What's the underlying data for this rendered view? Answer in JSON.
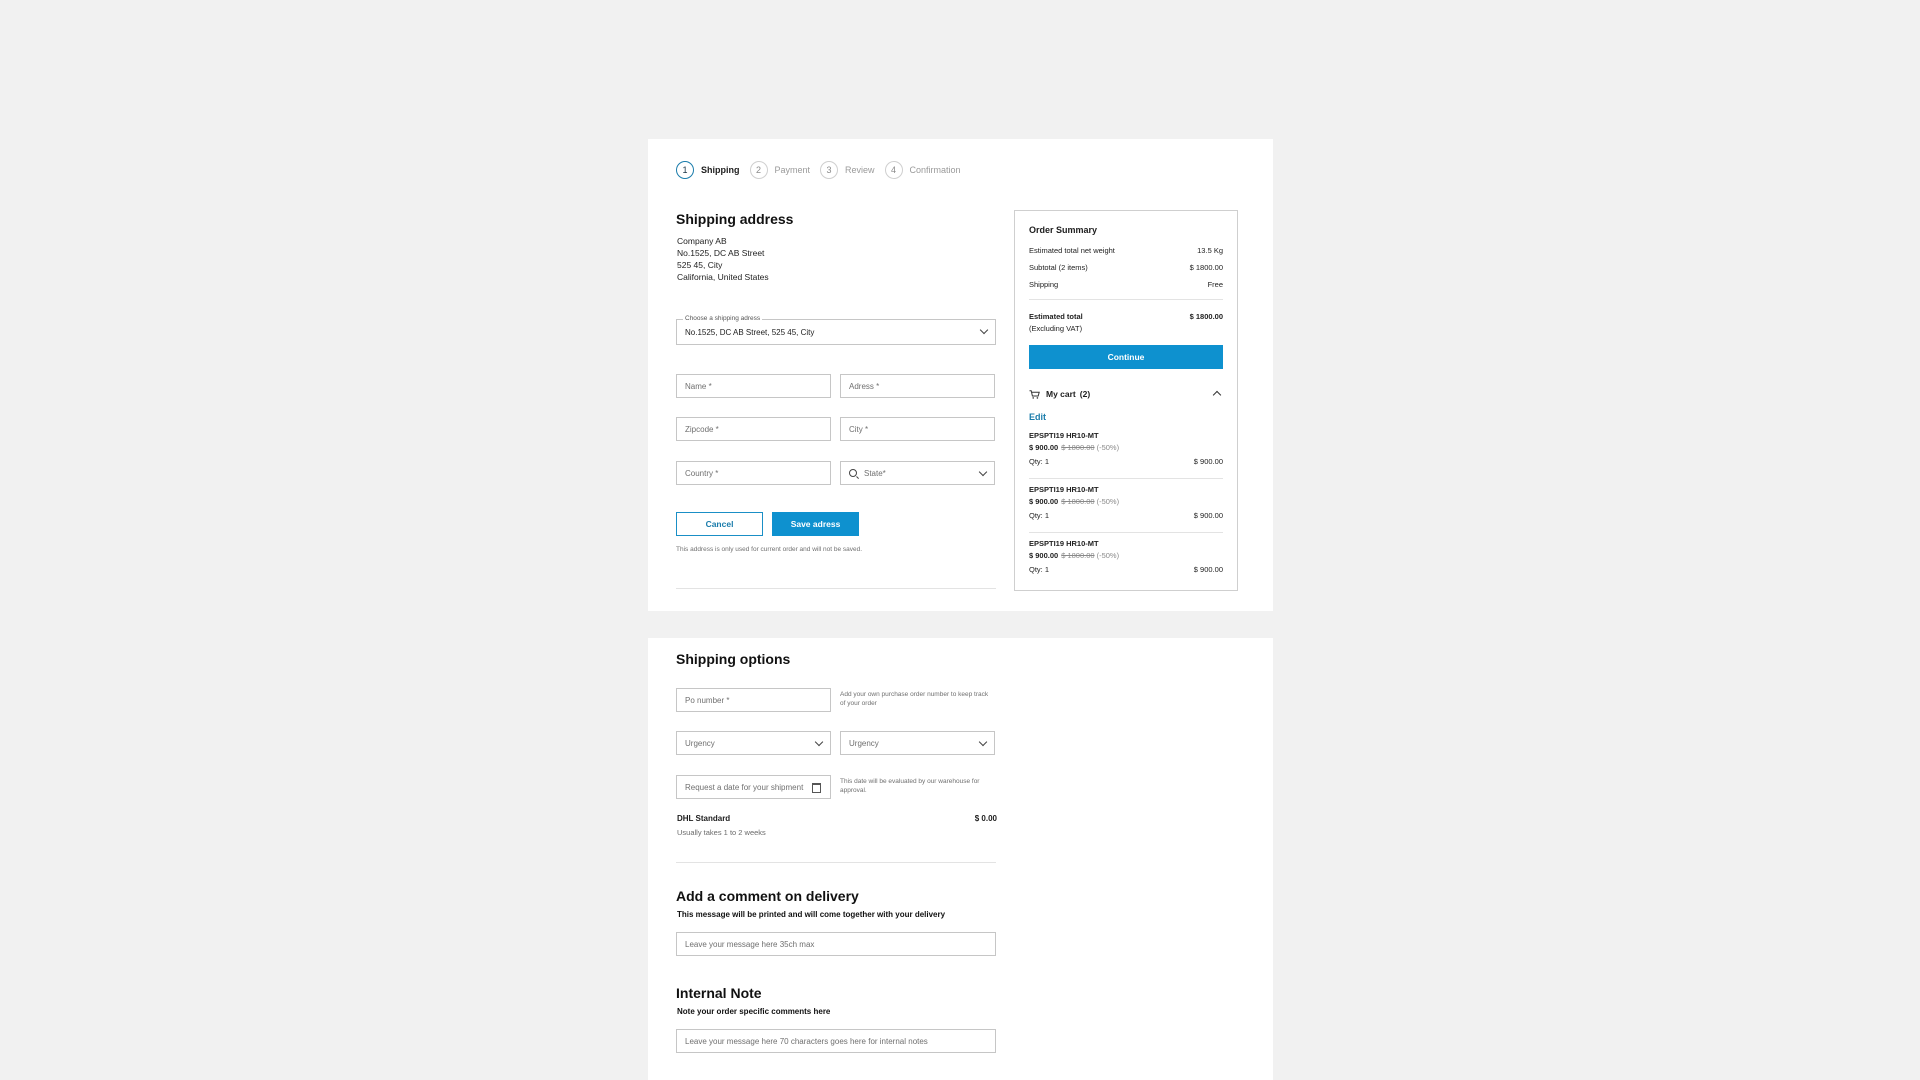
{
  "stepper": [
    {
      "number": "1",
      "label": "Shipping"
    },
    {
      "number": "2",
      "label": "Payment"
    },
    {
      "number": "3",
      "label": "Review"
    },
    {
      "number": "4",
      "label": "Confirmation"
    }
  ],
  "shipping_address": {
    "title": "Shipping address",
    "lines": [
      "Company AB",
      "No.1525, DC AB Street",
      "525 45, City",
      "California, United States"
    ],
    "select_label": "Choose a shipping adress",
    "select_value": "No.1525, DC AB Street, 525 45, City",
    "fields": {
      "name": "Name *",
      "address": "Adress *",
      "zipcode": "Zipcode *",
      "city": "City *",
      "country": "Country *",
      "state": "State*"
    },
    "cancel_label": "Cancel",
    "save_label": "Save adress",
    "note": "This address is only used for current order and will not be saved."
  },
  "order_summary": {
    "title": "Order Summary",
    "rows": [
      {
        "label": "Estimated total net weight",
        "value": "13.5 Kg"
      },
      {
        "label": "Subtotal (2 items)",
        "value": "$ 1800.00"
      },
      {
        "label": "Shipping",
        "value": "Free"
      }
    ],
    "total_label": "Estimated total",
    "total_sub": "(Excluding VAT)",
    "total_value": "$ 1800.00",
    "continue_label": "Continue",
    "cart_label": "My cart",
    "cart_count": "(2)",
    "edit_label": "Edit",
    "items": [
      {
        "name": "EPSPTI19 HR10-MT",
        "price": "$ 900.00",
        "old_price": "$ 1800.00",
        "discount": "(-50%)",
        "qty": "Qty: 1",
        "line_total": "$ 900.00"
      },
      {
        "name": "EPSPTI19 HR10-MT",
        "price": "$ 900.00",
        "old_price": "$ 1800.00",
        "discount": "(-50%)",
        "qty": "Qty: 1",
        "line_total": "$ 900.00"
      },
      {
        "name": "EPSPTI19 HR10-MT",
        "price": "$ 900.00",
        "old_price": "$ 1800.00",
        "discount": "(-50%)",
        "qty": "Qty: 1",
        "line_total": "$ 900.00"
      }
    ]
  },
  "shipping_options": {
    "title": "Shipping options",
    "po_placeholder": "Po number *",
    "po_note": "Add your own purchase order number to keep track of your order",
    "urgency_1": "Urgency",
    "urgency_2": "Urgency",
    "date_placeholder": "Request a date for your shipment",
    "date_note": "This date will be evaluated by our warehouse for approval.",
    "carrier_name": "DHL Standard",
    "carrier_desc": "Usually takes 1 to 2 weeks",
    "carrier_price": "$ 0.00"
  },
  "delivery_comment": {
    "title": "Add a comment on delivery",
    "subtitle": "This message will be printed and will come together with your delivery",
    "placeholder": "Leave your message here 35ch max"
  },
  "internal_note": {
    "title": "Internal Note",
    "subtitle": "Note your order specific comments here",
    "placeholder": "Leave your message here 70 characters goes here for internal notes"
  },
  "colors": {
    "accent": "#0e91cf",
    "background": "#f1f1f1"
  }
}
